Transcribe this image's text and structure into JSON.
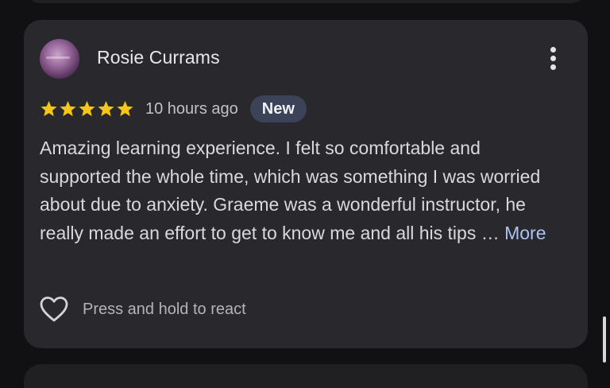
{
  "review": {
    "reviewer_name": "Rosie Currams",
    "avatar_icon": "profile-photo",
    "more_options_icon": "vertical-dots-icon",
    "rating": 5,
    "rating_max": 5,
    "star_color": "#f5c518",
    "time_ago": "10 hours ago",
    "badge": "New",
    "text": "Amazing learning experience. I felt so comfortable and supported the whole time, which was something I was worried about due to anxiety. Graeme was a wonderful instructor, he really made an effort to get to know me and all his tips …",
    "more_label": "More",
    "react_icon": "heart-outline-icon",
    "react_label": "Press and hold to react"
  },
  "colors": {
    "background": "#111113",
    "card": "#29292d",
    "badge_bg": "#3c4257",
    "link": "#a8c4f5"
  }
}
